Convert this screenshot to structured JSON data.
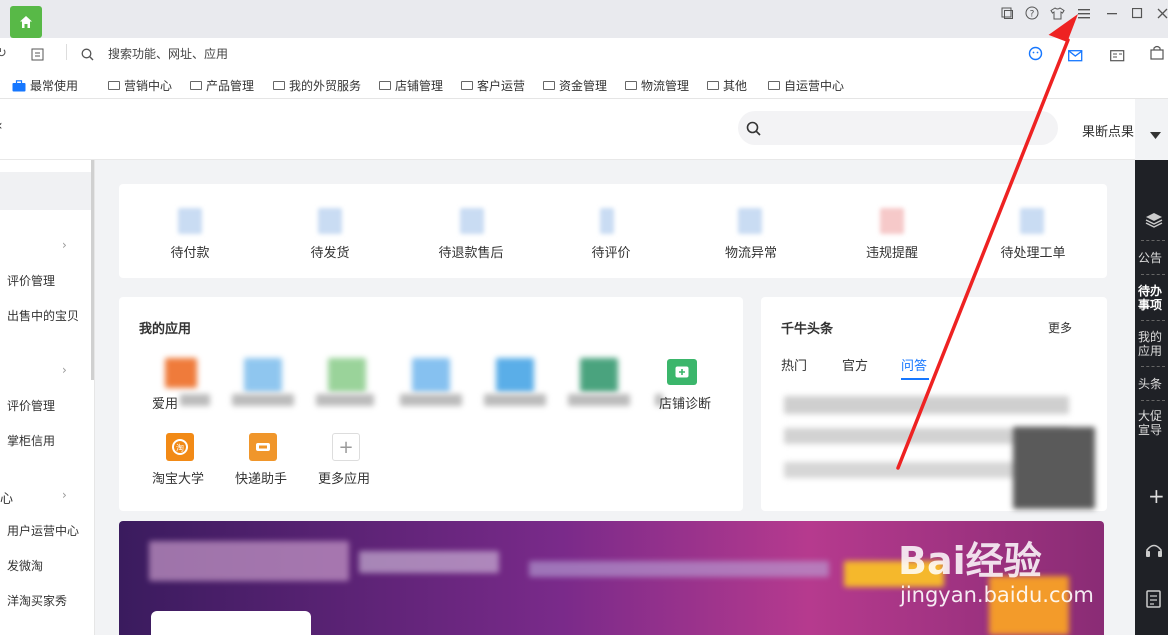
{
  "search": {
    "placeholder": "搜索功能、网址、应用"
  },
  "bookmarks": [
    "最常使用",
    "营销中心",
    "产品管理",
    "我的外贸服务",
    "店铺管理",
    "客户运营",
    "资金管理",
    "物流管理",
    "其他",
    "自运营中心"
  ],
  "header": {
    "store_name": "果断点果"
  },
  "sidebar": {
    "items": [
      "评价管理",
      "出售中的宝贝",
      "评价管理",
      "掌柜信用",
      "用户运营中心",
      "发微淘",
      "洋淘买家秀"
    ],
    "section_label": "心"
  },
  "todos": [
    "待付款",
    "待发货",
    "待退款售后",
    "待评价",
    "物流异常",
    "违规提醒",
    "待处理工单"
  ],
  "my_apps": {
    "title": "我的应用",
    "apps": [
      "淘宝大学",
      "快递助手",
      "更多应用"
    ],
    "partial_labels": [
      "爱用",
      "店铺诊断"
    ]
  },
  "news": {
    "title": "千牛头条",
    "more": "更多",
    "tabs": [
      "热门",
      "官方",
      "问答"
    ],
    "active_tab": "问答"
  },
  "right_panel": [
    "公告",
    "待办事项",
    "我的应用",
    "头条",
    "大促宣导"
  ],
  "watermark": {
    "brand": "Bai经验",
    "url": "jingyan.baidu.com"
  },
  "colors": {
    "accent": "#1677ff",
    "home_green": "#58b947",
    "arrow_red": "#ee2222"
  }
}
